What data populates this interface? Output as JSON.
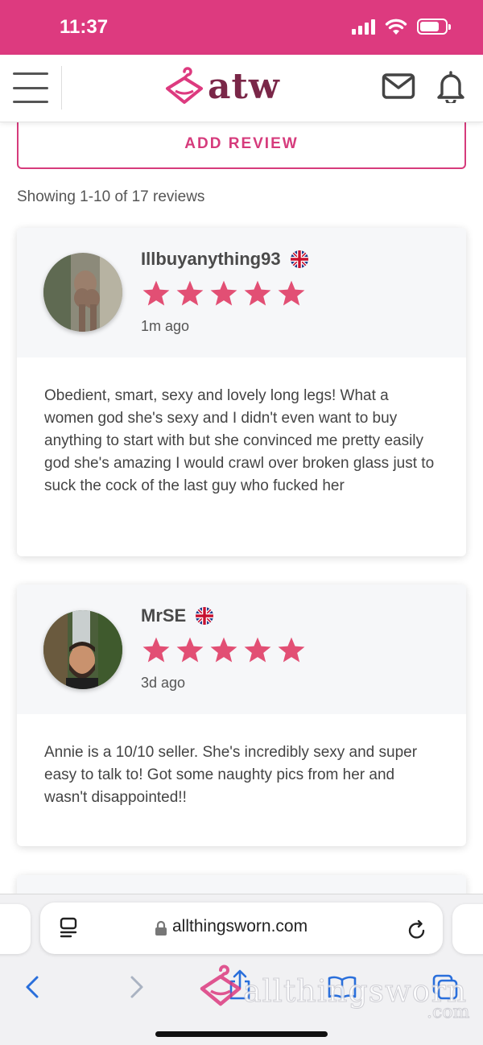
{
  "status_bar": {
    "time": "11:37",
    "battery_level": 0.78
  },
  "header": {
    "logo_text": "atw",
    "brand_color": "#7a2748",
    "accent": "#dd3a7f"
  },
  "actions": {
    "add_review_label": "ADD REVIEW"
  },
  "reviews_summary": "Showing 1-10 of 17 reviews",
  "reviews": [
    {
      "name": "Illbuyanything93",
      "country_flag": "uk-flag-icon",
      "rating": 5,
      "time": "1m ago",
      "text": "Obedient, smart, sexy and lovely long legs! What a women god she's sexy and I didn't even want to buy anything to start with but she convinced me pretty easily god she's amazing I would crawl over broken glass just to suck the cock of the last guy who fucked her"
    },
    {
      "name": "MrSE",
      "country_flag": "uk-flag-icon",
      "rating": 5,
      "time": "3d ago",
      "text": "Annie is a 10/10 seller. She's incredibly sexy and super easy to talk to! Got some naughty pics from her and wasn't disappointed!!"
    }
  ],
  "browser": {
    "url": "allthingsworn.com",
    "watermark": "allthingsworn",
    "watermark_suffix": ".com"
  }
}
